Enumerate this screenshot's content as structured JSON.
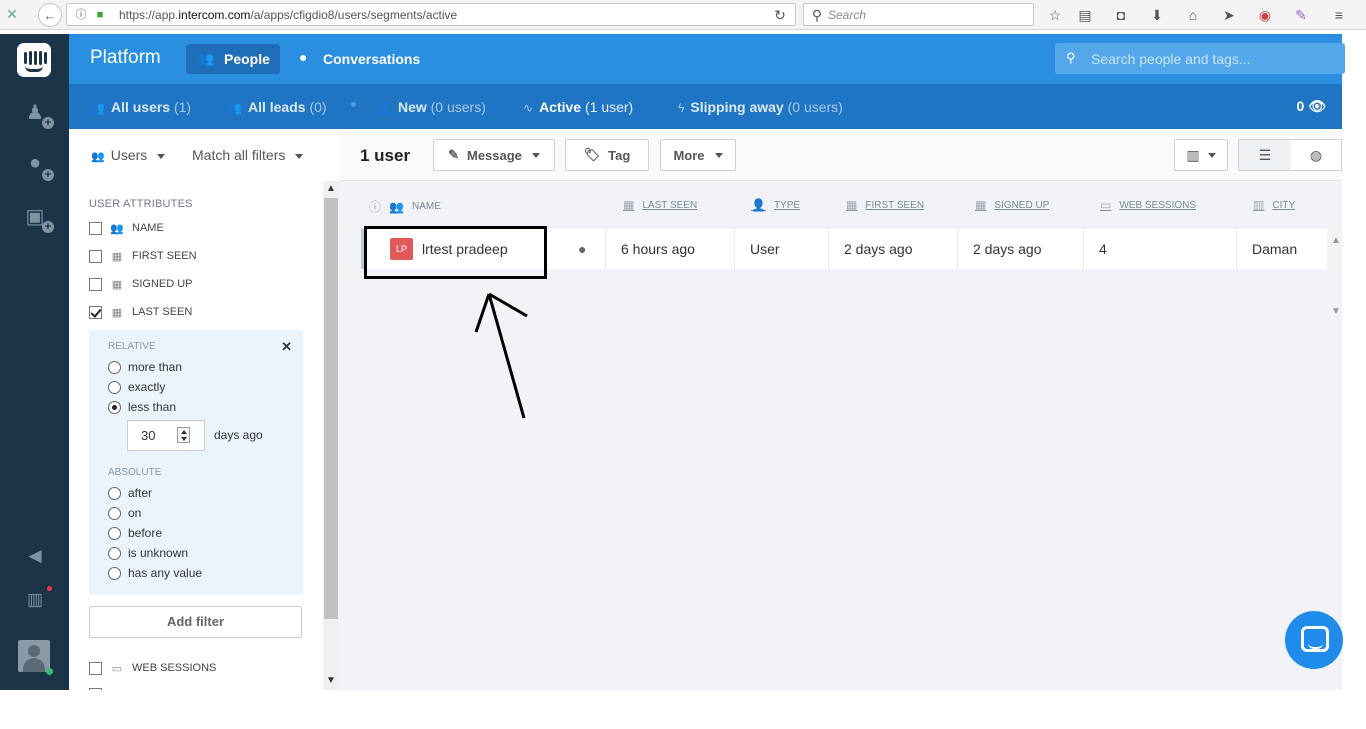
{
  "browser": {
    "url_prefix": "https://app.",
    "url_domain": "intercom.com",
    "url_path": "/a/apps/cfigdio8/users/segments/active",
    "search_placeholder": "Search"
  },
  "header": {
    "brand": "Platform",
    "nav_people": "People",
    "nav_conversations": "Conversations",
    "search_placeholder": "Search people and tags..."
  },
  "segments": [
    {
      "label": "All users",
      "count": "(1)"
    },
    {
      "label": "All leads",
      "count": "(0)"
    },
    {
      "label": "New",
      "count": "(0 users)"
    },
    {
      "label": "Active",
      "count": "(1 user)"
    },
    {
      "label": "Slipping away",
      "count": "(0 users)"
    }
  ],
  "viewing_count": "0",
  "filters": {
    "type_select": "Users",
    "match_select": "Match all filters",
    "section_label": "USER ATTRIBUTES",
    "attributes": [
      {
        "label": "NAME",
        "checked": false
      },
      {
        "label": "FIRST SEEN",
        "checked": false
      },
      {
        "label": "SIGNED UP",
        "checked": false
      },
      {
        "label": "LAST SEEN",
        "checked": true
      }
    ],
    "relative_title": "RELATIVE",
    "relative_options": [
      "more than",
      "exactly",
      "less than"
    ],
    "relative_selected": "less than",
    "days_value": "30",
    "days_suffix": "days ago",
    "absolute_title": "ABSOLUTE",
    "absolute_options": [
      "after",
      "on",
      "before",
      "is unknown",
      "has any value"
    ],
    "add_filter": "Add filter",
    "after_attribute": "WEB SESSIONS"
  },
  "toolbar": {
    "user_count": "1 user",
    "message": "Message",
    "tag": "Tag",
    "more": "More"
  },
  "columns": [
    "NAME",
    "LAST SEEN",
    "TYPE",
    "FIRST SEEN",
    "SIGNED UP",
    "WEB SESSIONS",
    "CITY"
  ],
  "rows": [
    {
      "initials": "LP",
      "name": "lrtest pradeep",
      "last_seen": "6 hours ago",
      "type": "User",
      "first_seen": "2 days ago",
      "signed_up": "2 days ago",
      "web_sessions": "4",
      "city": "Daman"
    }
  ]
}
